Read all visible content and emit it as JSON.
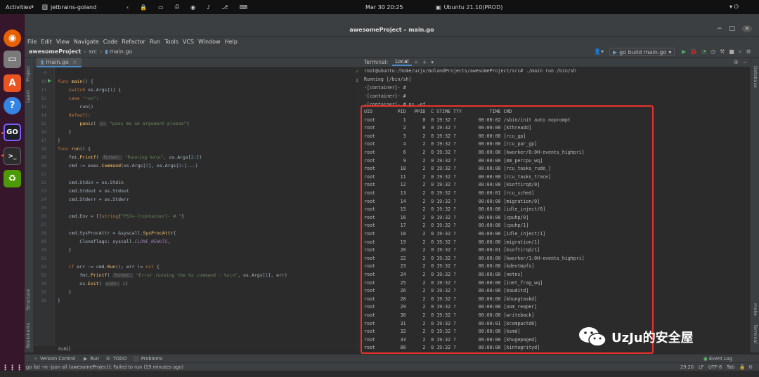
{
  "topbar": {
    "activities": "Activities",
    "app": "jetbrains-goland",
    "clock": "Mar 30  20:25",
    "vm_title": "Ubuntu 21.10(PROD)"
  },
  "window": {
    "title": "awesomeProject – main.go"
  },
  "menu": [
    "File",
    "Edit",
    "View",
    "Navigate",
    "Code",
    "Refactor",
    "Run",
    "Tools",
    "VCS",
    "Window",
    "Help"
  ],
  "nav": {
    "project": "awesomeProject",
    "folder": "src",
    "file": "main.go",
    "run_config": "go build main.go"
  },
  "editor": {
    "tab": "main.go",
    "line_numbers": [
      "9",
      "10",
      "11",
      "12",
      "13",
      "14",
      "15",
      "16",
      "17",
      "18",
      "19",
      "20",
      "21",
      "22",
      "23",
      "24",
      "25",
      "26",
      "27",
      "28",
      "29",
      "30",
      "31",
      "32",
      "33",
      "34",
      "35",
      "36"
    ],
    "run_label": "run()"
  },
  "left_tools": {
    "project": "Project",
    "learn": "Learn",
    "structure": "Structure",
    "bookmarks": "Bookmarks"
  },
  "right_tools": {
    "database": "Database",
    "make": "make",
    "terminal": "Terminal"
  },
  "terminal": {
    "label": "Terminal:",
    "tab": "Local",
    "lines": [
      "root@ubuntu:/home/uzju/GolandProjects/awesomeProject/src# ./main run /bin/sh",
      "Running [/bin/sh]",
      "-[container]- #",
      "-[container]- #",
      "-[container]- # ps -ef"
    ],
    "ps_header": "UID         PID   PPID  C STIME TTY          TIME CMD",
    "ps_rows": [
      "root          1      0  0 19:32 ?        00:00:02 /sbin/init auto noprompt",
      "root          2      0  0 19:32 ?        00:00:00 [kthreadd]",
      "root          3      2  0 19:32 ?        00:00:00 [rcu_gp]",
      "root          4      2  0 19:32 ?        00:00:00 [rcu_par_gp]",
      "root          6      2  0 19:32 ?        00:00:00 [kworker/0:0H-events_highpri]",
      "root          9      2  0 19:32 ?        00:00:00 [mm_percpu_wq]",
      "root         10      2  0 19:32 ?        00:00:00 [rcu_tasks_rude_]",
      "root         11      2  0 19:32 ?        00:00:00 [rcu_tasks_trace]",
      "root         12      2  0 19:32 ?        00:00:00 [ksoftirqd/0]",
      "root         13      2  0 19:32 ?        00:00:01 [rcu_sched]",
      "root         14      2  0 19:32 ?        00:00:00 [migration/0]",
      "root         15      2  0 19:32 ?        00:00:00 [idle_inject/0]",
      "root         16      2  0 19:32 ?        00:00:00 [cpuhp/0]",
      "root         17      2  0 19:32 ?        00:00:00 [cpuhp/1]",
      "root         18      2  0 19:32 ?        00:00:00 [idle_inject/1]",
      "root         19      2  0 19:32 ?        00:00:00 [migration/1]",
      "root         20      2  0 19:32 ?        00:00:01 [ksoftirqd/1]",
      "root         22      2  0 19:32 ?        00:00:00 [kworker/1:0H-events_highpri]",
      "root         23      2  0 19:32 ?        00:00:00 [kdevtmpfs]",
      "root         24      2  0 19:32 ?        00:00:00 [netns]",
      "root         25      2  0 19:32 ?        00:00:00 [inet_frag_wq]",
      "root         26      2  0 19:32 ?        00:00:00 [kauditd]",
      "root         28      2  0 19:32 ?        00:00:00 [khungtaskd]",
      "root         29      2  0 19:32 ?        00:00:00 [oom_reaper]",
      "root         30      2  0 19:32 ?        00:00:00 [writeback]",
      "root         31      2  0 19:32 ?        00:00:01 [kcompactd0]",
      "root         32      2  0 19:32 ?        00:00:00 [ksmd]",
      "root         33      2  0 19:32 ?        00:00:00 [khugepaged]",
      "root         80      2  0 19:32 ?        00:00:00 [kintegrityd]"
    ]
  },
  "bottom_tools": {
    "vcs": "Version Control",
    "run": "Run",
    "todo": "TODO",
    "problems": "Problems",
    "event_log": "Event Log"
  },
  "status": {
    "message": "go list -m -json all (awesomeProject): Failed to run (19 minutes ago)",
    "position": "29:20",
    "line_sep": "LF",
    "encoding": "UTF-8",
    "indent": "Tab"
  },
  "watermark": {
    "text": "UzJu的安全屋"
  },
  "colors": {
    "highlight_box": "#e8322c",
    "keyword": "#cc7832",
    "function": "#ffc66d",
    "string": "#6a8759"
  }
}
